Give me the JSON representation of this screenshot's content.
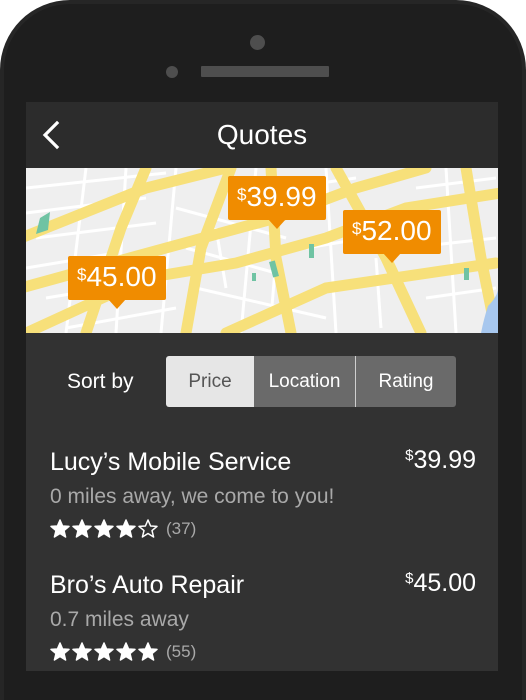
{
  "header": {
    "title": "Quotes",
    "back_icon": "chevron-left-icon"
  },
  "map": {
    "pins": [
      {
        "currency": "$",
        "amount": "45.00"
      },
      {
        "currency": "$",
        "amount": "39.99"
      },
      {
        "currency": "$",
        "amount": "52.00"
      }
    ],
    "colors": {
      "pin": "#f08c00",
      "road": "#f7e07a",
      "park": "#6fc3a3",
      "water": "#a7c7ee",
      "land": "#efefef"
    }
  },
  "sort": {
    "label": "Sort by",
    "options": [
      "Price",
      "Location",
      "Rating"
    ],
    "selected": "Price"
  },
  "results": [
    {
      "name": "Lucy’s Mobile Service",
      "currency": "$",
      "price": "39.99",
      "distance": "0 miles away, we come to you!",
      "rating": 4,
      "rating_out_of": 5,
      "reviews": "(37)"
    },
    {
      "name": "Bro’s Auto Repair",
      "currency": "$",
      "price": "45.00",
      "distance": "0.7 miles away",
      "rating": 5,
      "rating_out_of": 5,
      "reviews": "(55)"
    }
  ],
  "theme": {
    "screen_bg": "#323232",
    "topbar_bg": "#2c2c2c",
    "text_primary": "#ffffff",
    "text_secondary": "#a9a9a9"
  }
}
